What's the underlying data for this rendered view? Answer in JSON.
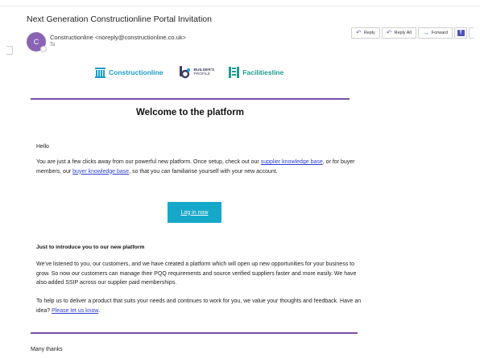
{
  "email": {
    "subject": "Next Generation Constructionline Portal Invitation",
    "avatar_initial": "C",
    "sender": "Constructionline <noreply@constructionline.co.uk>",
    "to": "To"
  },
  "actions": {
    "reply": "Reply",
    "reply_all": "Reply All",
    "forward": "Forward"
  },
  "logos": {
    "constructionline": "Constructionline",
    "builders_profile_line1": "BUILDER'S",
    "builders_profile_line2": "PROFILE",
    "facilitiesline": "Facilitiesline"
  },
  "body": {
    "heading": "Welcome to the platform",
    "greeting": "Hello",
    "p1_a": "You are just a few clicks away from our powerful new platform. Once setup, check out our ",
    "p1_link1": "supplier knowledge base",
    "p1_b": ", or for buyer members, our ",
    "p1_link2": "buyer knowledge base",
    "p1_c": ", so that you can familiarise yourself with your new account.",
    "cta": "Log in now",
    "section_heading": "Just to introduce you to our new platform",
    "p2": "We've listened to you, our customers, and we have created a platform which will open up new opportunities for your business to grow. So now our customers can manage their PQQ requirements and source verified suppliers faster and more easily. We have also added SSIP across our supplier paid memberships.",
    "p3_a": "To help us to deliver a product that suits your needs and continues to work for you, we value your thoughts and feedback. Have an idea? ",
    "p3_link": "Please let us know",
    "p3_b": ".",
    "sign_off": "Many thanks"
  },
  "colors": {
    "accent_purple": "#7b4da8",
    "cta_teal": "#16a8c9",
    "link_blue": "#2c3fd6"
  }
}
